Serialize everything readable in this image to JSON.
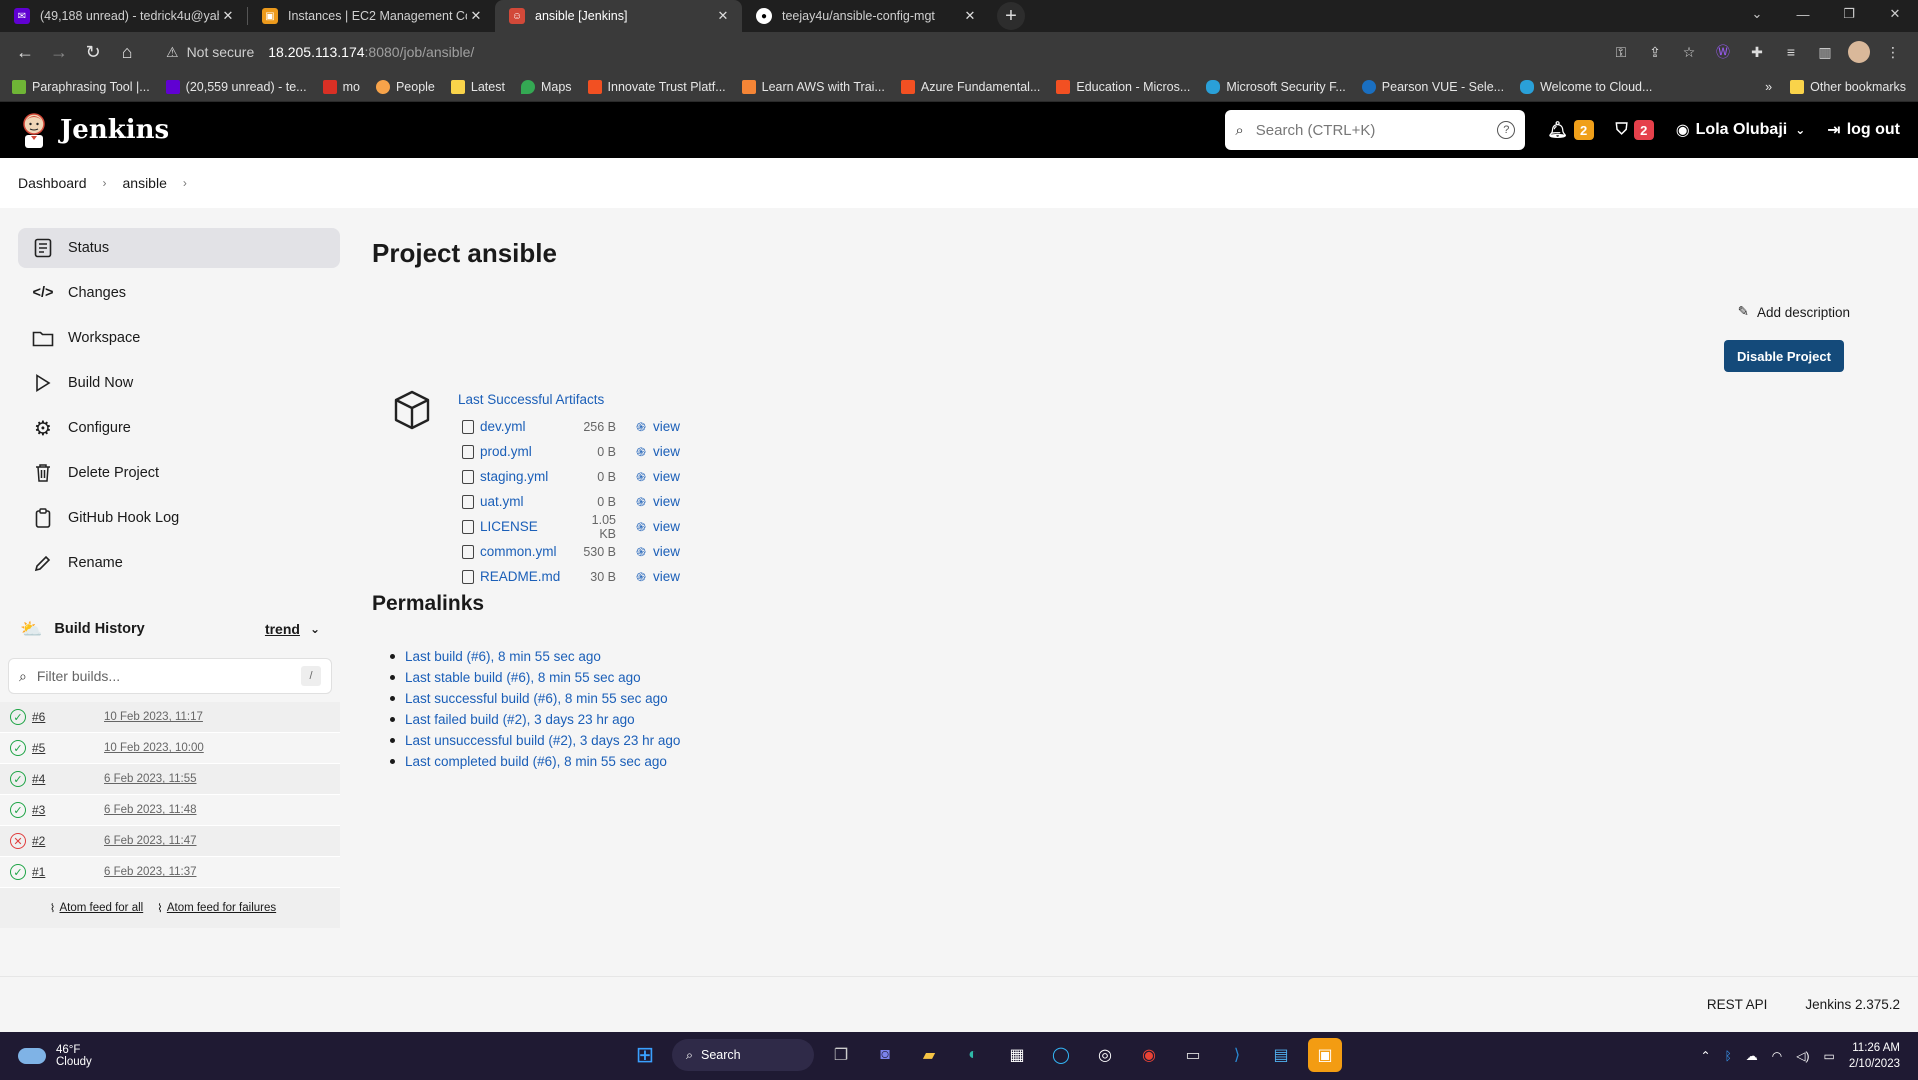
{
  "browser": {
    "tabs": [
      {
        "title": "(49,188 unread) - tedrick4u@yah",
        "icon": "yahoo-mail-icon",
        "color": "#6001d2",
        "active": false
      },
      {
        "title": "Instances | EC2 Management Co",
        "icon": "aws-icon",
        "color": "#ec9a1c",
        "active": false
      },
      {
        "title": "ansible [Jenkins]",
        "icon": "jenkins-icon",
        "color": "#d24939",
        "active": true
      },
      {
        "title": "teejay4u/ansible-config-mgt",
        "icon": "github-icon",
        "color": "#ffffff",
        "active": false
      }
    ],
    "new_tab_label": "+",
    "url": {
      "security": "Not secure",
      "host": "18.205.113.174",
      "path": ":8080/job/ansible/"
    },
    "bookmarks": [
      {
        "label": "Paraphrasing Tool |...",
        "color": "#6fb536"
      },
      {
        "label": "(20,559 unread) - te...",
        "color": "#6001d2"
      },
      {
        "label": "mo",
        "color": "#d93025"
      },
      {
        "label": "People",
        "color": "#f7a34a"
      },
      {
        "label": "Latest",
        "color": "#f9d34a"
      },
      {
        "label": "Maps",
        "color": "#34a853"
      },
      {
        "label": "Innovate Trust Platf...",
        "color": "#f25022"
      },
      {
        "label": "Learn AWS with Trai...",
        "color": "#f58536"
      },
      {
        "label": "Azure Fundamental...",
        "color": "#f25022"
      },
      {
        "label": "Education - Micros...",
        "color": "#f25022"
      },
      {
        "label": "Microsoft Security F...",
        "color": "#2aa0d8"
      },
      {
        "label": "Pearson VUE - Sele...",
        "color": "#1a6fc1"
      },
      {
        "label": "Welcome to Cloud...",
        "color": "#2aa0d8"
      }
    ],
    "bookmarks_more": "»",
    "other_bookmarks": "Other bookmarks"
  },
  "jenkins": {
    "brand": "Jenkins",
    "search_placeholder": "Search (CTRL+K)",
    "notifications_count": "2",
    "security_count": "2",
    "user_name": "Lola Olubaji",
    "logout_label": "log out",
    "breadcrumb": [
      "Dashboard",
      "ansible"
    ],
    "sidebar": [
      {
        "label": "Status",
        "icon": "status-icon"
      },
      {
        "label": "Changes",
        "icon": "code-icon"
      },
      {
        "label": "Workspace",
        "icon": "folder-icon"
      },
      {
        "label": "Build Now",
        "icon": "play-icon"
      },
      {
        "label": "Configure",
        "icon": "gear-icon"
      },
      {
        "label": "Delete Project",
        "icon": "trash-icon"
      },
      {
        "label": "GitHub Hook Log",
        "icon": "clipboard-icon"
      },
      {
        "label": "Rename",
        "icon": "pencil-icon"
      }
    ],
    "build_history": {
      "title": "Build History",
      "trend_label": "trend",
      "filter_placeholder": "Filter builds...",
      "filter_shortcut": "/",
      "builds": [
        {
          "number": "#6",
          "date": "10 Feb 2023, 11:17",
          "status": "success"
        },
        {
          "number": "#5",
          "date": "10 Feb 2023, 10:00",
          "status": "success"
        },
        {
          "number": "#4",
          "date": "6 Feb 2023, 11:55",
          "status": "success"
        },
        {
          "number": "#3",
          "date": "6 Feb 2023, 11:48",
          "status": "success"
        },
        {
          "number": "#2",
          "date": "6 Feb 2023, 11:47",
          "status": "failed"
        },
        {
          "number": "#1",
          "date": "6 Feb 2023, 11:37",
          "status": "success"
        }
      ],
      "feed_all": "Atom feed for all",
      "feed_failures": "Atom feed for failures"
    },
    "project_title": "Project ansible",
    "add_description": "Add description",
    "disable_button": "Disable Project",
    "artifacts": {
      "title": "Last Successful Artifacts",
      "view_label": "view",
      "files": [
        {
          "name": "dev.yml",
          "size": "256 B"
        },
        {
          "name": "prod.yml",
          "size": "0 B"
        },
        {
          "name": "staging.yml",
          "size": "0 B"
        },
        {
          "name": "uat.yml",
          "size": "0 B"
        },
        {
          "name": "LICENSE",
          "size": "1.05 KB"
        },
        {
          "name": "common.yml",
          "size": "530 B"
        },
        {
          "name": "README.md",
          "size": "30 B"
        }
      ]
    },
    "permalinks": {
      "title": "Permalinks",
      "links": [
        "Last build (#6), 8 min 55 sec ago",
        "Last stable build (#6), 8 min 55 sec ago",
        "Last successful build (#6), 8 min 55 sec ago",
        "Last failed build (#2), 3 days 23 hr ago",
        "Last unsuccessful build (#2), 3 days 23 hr ago",
        "Last completed build (#6), 8 min 55 sec ago"
      ]
    },
    "footer": {
      "rest_api": "REST API",
      "version": "Jenkins 2.375.2"
    }
  },
  "taskbar": {
    "temperature": "46°F",
    "condition": "Cloudy",
    "search_label": "Search",
    "time": "11:26 AM",
    "date": "2/10/2023"
  },
  "colors": {
    "link": "#1b5fb8",
    "primary_button": "#144a7a",
    "success": "#1ea446",
    "failure": "#e03c3c"
  }
}
